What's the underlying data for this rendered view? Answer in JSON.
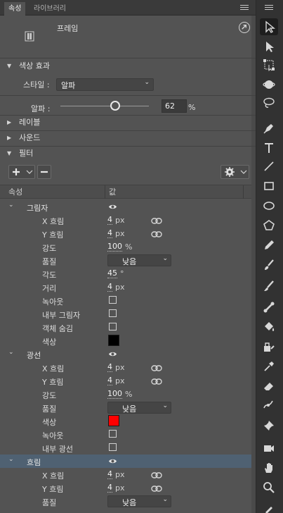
{
  "tabs": [
    {
      "label": "속성"
    },
    {
      "label": "라이브러리"
    }
  ],
  "frame": {
    "label": "프레임"
  },
  "sections": {
    "color_effect": "색상 효과",
    "layer": "레이블",
    "sound": "사운드",
    "filter": "필터"
  },
  "style": {
    "label": "스타일 :",
    "value": "알파"
  },
  "alpha": {
    "label": "알파 :",
    "value": "62",
    "unit": "%",
    "level": 0.62
  },
  "table": {
    "col_property": "속성",
    "col_value": "값"
  },
  "filters": [
    {
      "name": "그림자",
      "rows": [
        {
          "type": "num",
          "label": "X 흐림",
          "value": "4",
          "unit": "px",
          "link": true
        },
        {
          "type": "num",
          "label": "Y 흐림",
          "value": "4",
          "unit": "px",
          "link": true
        },
        {
          "type": "num",
          "label": "강도",
          "value": "100",
          "unit": "%"
        },
        {
          "type": "select",
          "label": "품질",
          "value": "낮음"
        },
        {
          "type": "num",
          "label": "각도",
          "value": "45",
          "unit": "°"
        },
        {
          "type": "num",
          "label": "거리",
          "value": "4",
          "unit": "px"
        },
        {
          "type": "check",
          "label": "녹아웃"
        },
        {
          "type": "check",
          "label": "내부 그림자"
        },
        {
          "type": "check",
          "label": "객체 숨김"
        },
        {
          "type": "color",
          "label": "색상",
          "color": "#000000"
        }
      ]
    },
    {
      "name": "광선",
      "rows": [
        {
          "type": "num",
          "label": "X 흐림",
          "value": "4",
          "unit": "px",
          "link": true
        },
        {
          "type": "num",
          "label": "Y 흐림",
          "value": "4",
          "unit": "px",
          "link": true
        },
        {
          "type": "num",
          "label": "강도",
          "value": "100",
          "unit": "%"
        },
        {
          "type": "select",
          "label": "품질",
          "value": "낮음"
        },
        {
          "type": "color",
          "label": "색상",
          "color": "#ff0000"
        },
        {
          "type": "check",
          "label": "녹아웃"
        },
        {
          "type": "check",
          "label": "내부 광선"
        }
      ]
    },
    {
      "name": "흐림",
      "selected": true,
      "rows": [
        {
          "type": "num",
          "label": "X 흐림",
          "value": "4",
          "unit": "px",
          "link": true
        },
        {
          "type": "num",
          "label": "Y 흐림",
          "value": "4",
          "unit": "px",
          "link": true
        },
        {
          "type": "select",
          "label": "품질",
          "value": "낮음"
        }
      ]
    }
  ],
  "tools": [
    "selection-icon",
    "subselection-icon",
    "free-transform-icon",
    "3d-rotation-icon",
    "lasso-icon",
    "pen-icon",
    "text-icon",
    "line-icon",
    "rectangle-icon",
    "oval-icon",
    "polystar-icon",
    "pencil-icon",
    "paint-brush-icon",
    "brush-icon",
    "bone-icon",
    "paint-bucket-icon",
    "ink-bottle-icon",
    "eyedropper-icon",
    "eraser-icon",
    "width-icon",
    "pin-icon",
    "camera-icon",
    "hand-icon",
    "zoom-icon",
    "stroke-color-icon"
  ]
}
